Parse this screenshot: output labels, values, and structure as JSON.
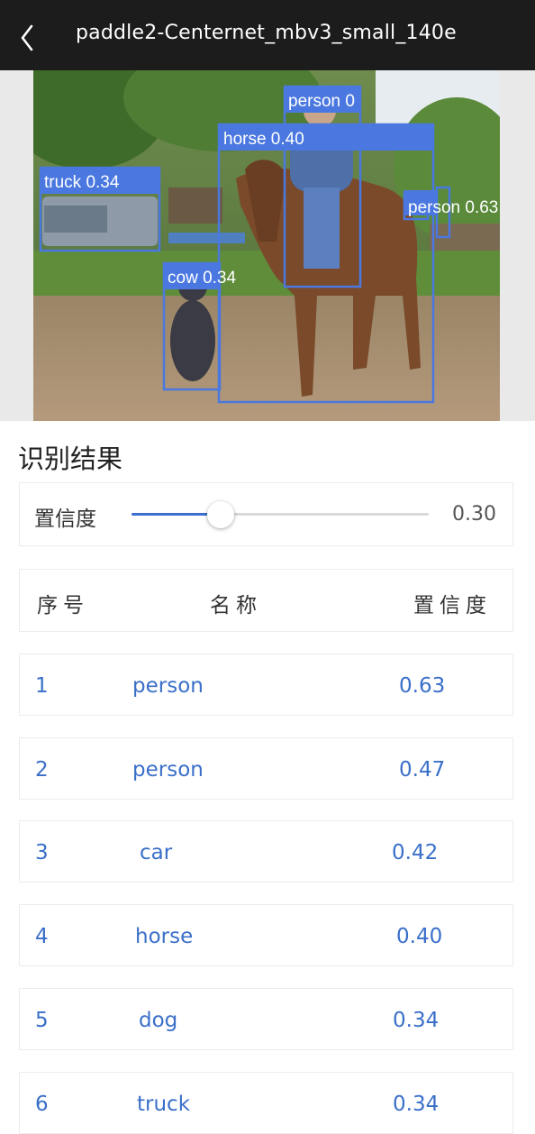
{
  "header": {
    "back_icon": "chevron-left-icon",
    "title": "paddle2-Centernet_mbv3_small_140e"
  },
  "detections_overlay": [
    {
      "label": "person 0",
      "color": "#4a78e0"
    },
    {
      "label": "horse 0.40",
      "color": "#4a78e0"
    },
    {
      "label": "truck 0.34",
      "color": "#4a78e0"
    },
    {
      "label": "cow 0.34",
      "color": "#4a78e0"
    },
    {
      "label": "person 0.63",
      "color": "#4a78e0"
    }
  ],
  "results": {
    "title": "识别结果",
    "confidence": {
      "label": "置信度",
      "value": "0.30",
      "fraction": 0.3,
      "accent": "#3a6fd0"
    },
    "columns": [
      "序号",
      "名称",
      "置信度"
    ],
    "rows": [
      {
        "index": "1",
        "name": "person",
        "score": "0.63"
      },
      {
        "index": "2",
        "name": "person",
        "score": "0.47"
      },
      {
        "index": "3",
        "name": "car",
        "score": "0.42"
      },
      {
        "index": "4",
        "name": "horse",
        "score": "0.40"
      },
      {
        "index": "5",
        "name": "dog",
        "score": "0.34"
      },
      {
        "index": "6",
        "name": "truck",
        "score": "0.34"
      }
    ]
  }
}
